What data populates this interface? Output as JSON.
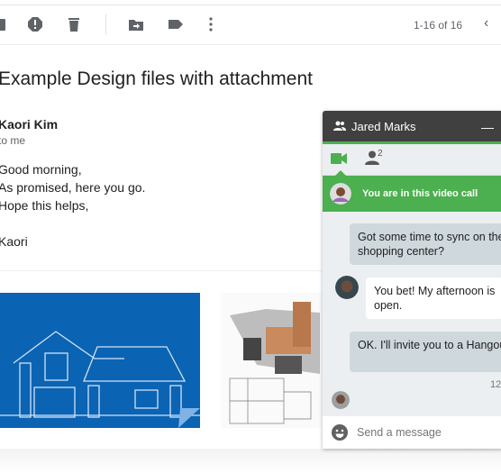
{
  "toolbar": {
    "icons": [
      "archive-icon",
      "report-spam-icon",
      "delete-icon",
      "move-to-icon",
      "label-icon",
      "more-icon"
    ],
    "pagination": "1-16 of 16"
  },
  "email": {
    "subject": "Example Design files with attachment",
    "sender": "Kaori Kim",
    "recipient": "to me",
    "body": [
      "Good morning,",
      "As promised, here you go.",
      "Hope this helps,",
      "",
      "Kaori"
    ],
    "attachments": [
      "blueprint-house-image",
      "architecture-sketch-image"
    ]
  },
  "chat": {
    "contact": "Jared Marks",
    "participant_count": "2",
    "banner": "You are in this video call",
    "messages": [
      {
        "from": "me",
        "lines": [
          "Got some time to sync on the",
          "shopping center?"
        ]
      },
      {
        "from": "them",
        "lines": [
          "You bet! My afternoon is",
          "open."
        ]
      },
      {
        "from": "me",
        "lines": [
          "OK. I'll invite you to a Hangout",
          ""
        ]
      }
    ],
    "time": "12",
    "input_placeholder": "Send a message",
    "accent": "#4caf50",
    "header_color": "#404040"
  }
}
